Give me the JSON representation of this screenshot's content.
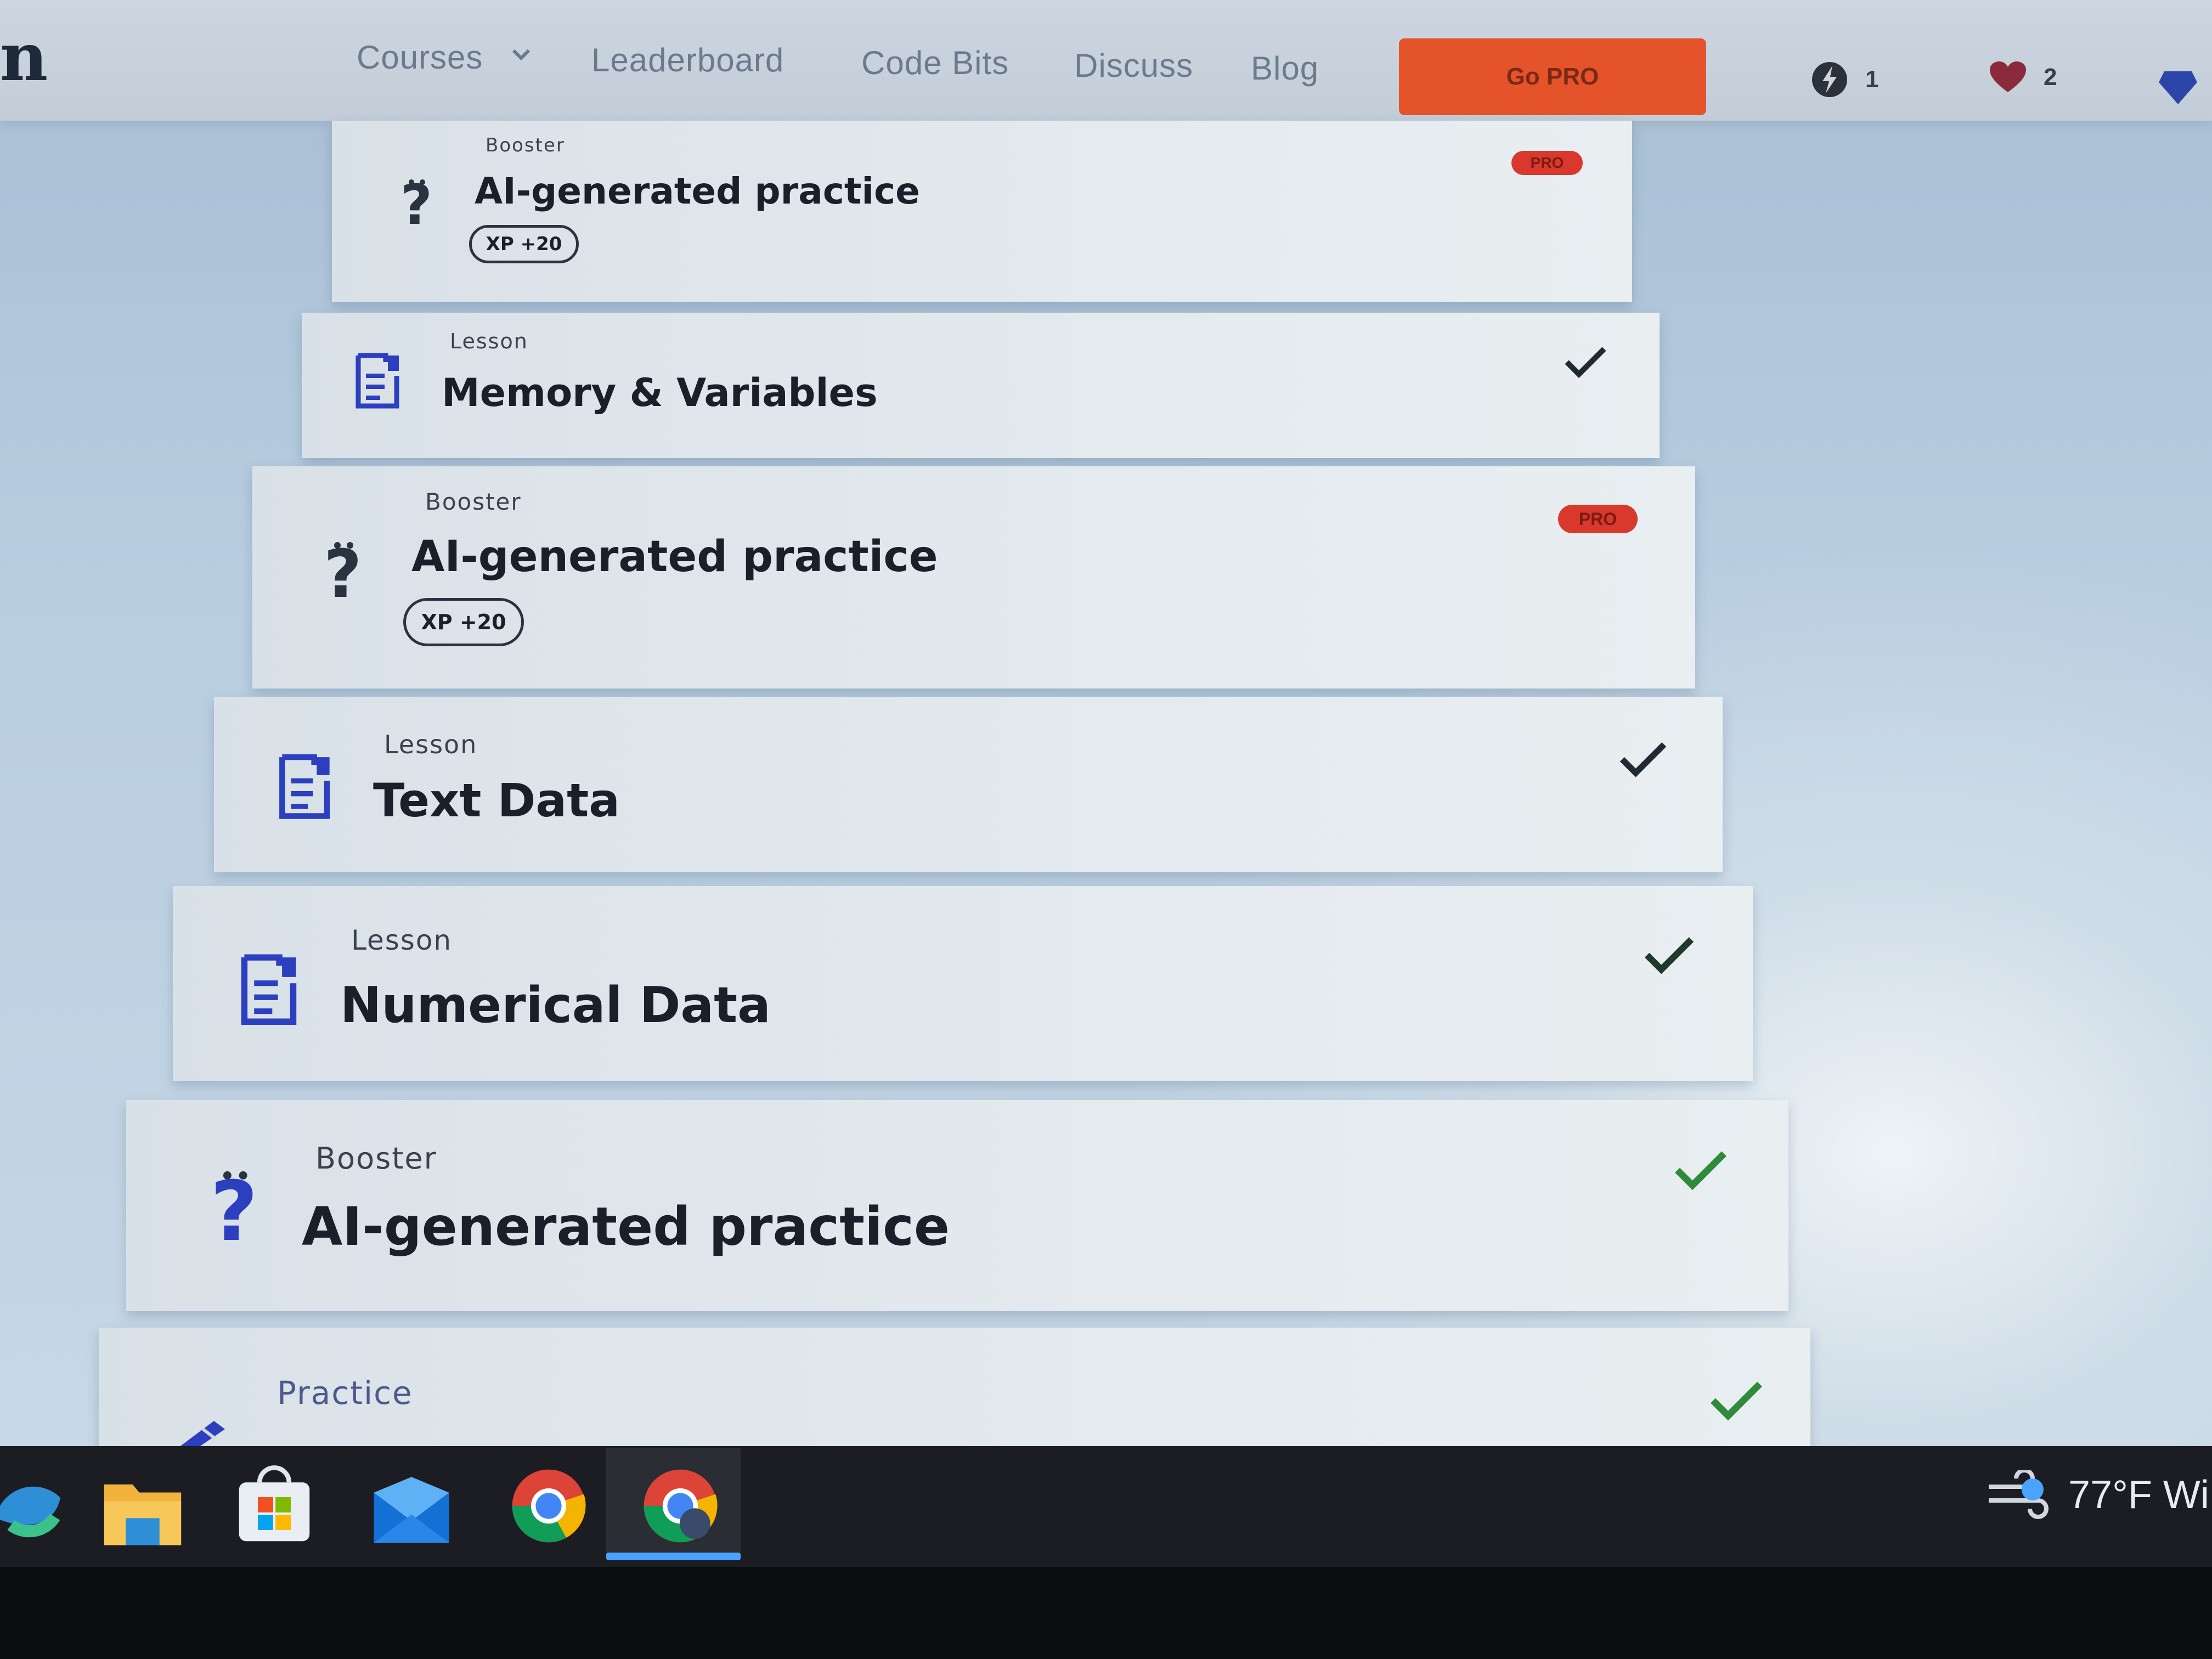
{
  "nav": {
    "logo": "n",
    "links": [
      "Courses",
      "Leaderboard",
      "Code Bits",
      "Discuss",
      "Blog"
    ],
    "go_pro": "Go PRO",
    "stats": [
      {
        "icon": "bolt-icon",
        "value": "1"
      },
      {
        "icon": "heart-icon",
        "value": "2"
      }
    ]
  },
  "cards": [
    {
      "type": "Booster",
      "title": "AI-generated practice",
      "xp": "XP +20",
      "pro": "PRO",
      "icon": "question-icon",
      "completed": false
    },
    {
      "type": "Lesson",
      "title": "Memory & Variables",
      "icon": "lesson-icon",
      "completed": true
    },
    {
      "type": "Booster",
      "title": "AI-generated practice",
      "xp": "XP +20",
      "pro": "PRO",
      "icon": "question-icon",
      "completed": false
    },
    {
      "type": "Lesson",
      "title": "Text Data",
      "icon": "lesson-icon",
      "completed": true
    },
    {
      "type": "Lesson",
      "title": "Numerical Data",
      "icon": "lesson-icon",
      "completed": true
    },
    {
      "type": "Booster",
      "title": "AI-generated practice",
      "icon": "question-icon",
      "completed": true
    },
    {
      "type": "Practice",
      "icon": "pencil-icon",
      "completed": true
    }
  ],
  "taskbar": {
    "apps": [
      "edge-icon",
      "file-explorer-icon",
      "store-icon",
      "mail-icon",
      "chrome-icon",
      "chrome-profile-icon"
    ],
    "weather": "77°F Wi"
  },
  "colors": {
    "accent": "#e5532b",
    "pro_badge": "#d9382c",
    "check_dark": "#1f2a33",
    "check_green": "#2e8b3a",
    "icon_blue": "#2b3fbf"
  }
}
